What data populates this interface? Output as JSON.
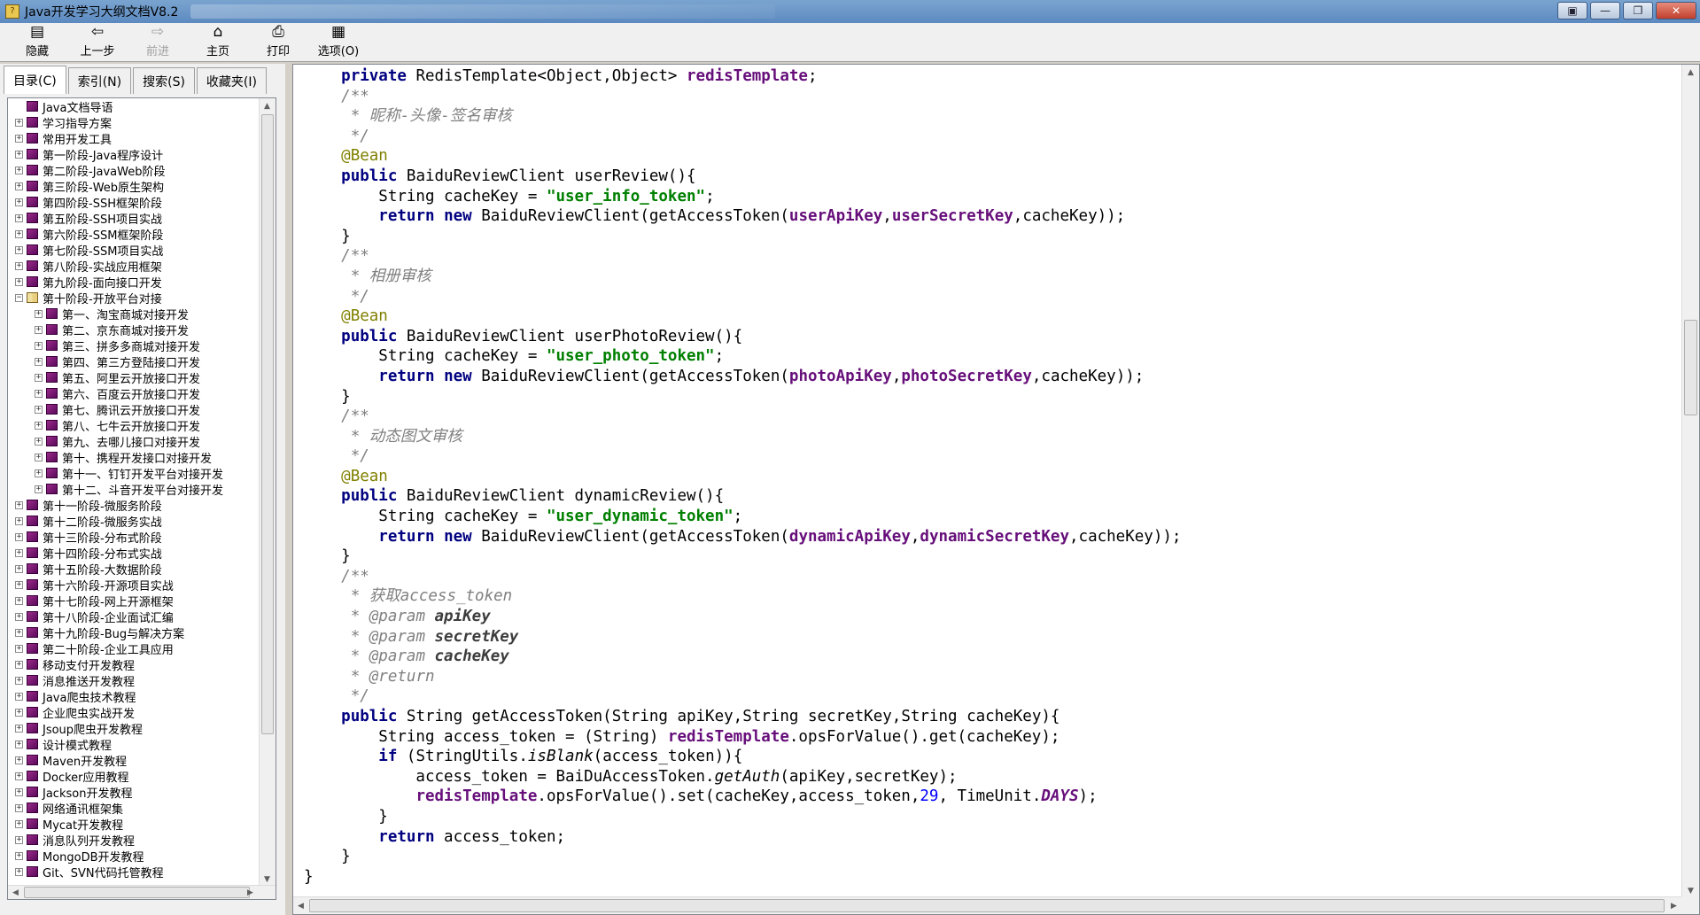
{
  "window": {
    "title": "Java开发学习大纲文档V8.2",
    "controls": [
      "▣",
      "—",
      "❐",
      "✕"
    ]
  },
  "toolbar": {
    "buttons": [
      {
        "label": "隐藏",
        "icon": "hide-icon",
        "glyph": "▤",
        "disabled": false
      },
      {
        "label": "上一步",
        "icon": "back-arrow-icon",
        "glyph": "⇦",
        "disabled": false
      },
      {
        "label": "前进",
        "icon": "forward-arrow-icon",
        "glyph": "⇨",
        "disabled": true
      },
      {
        "label": "主页",
        "icon": "home-icon",
        "glyph": "⌂",
        "disabled": false
      },
      {
        "label": "打印",
        "icon": "printer-icon",
        "glyph": "⎙",
        "disabled": false
      },
      {
        "label": "选项(O)",
        "icon": "options-icon",
        "glyph": "▦",
        "disabled": false
      }
    ]
  },
  "tabs": [
    {
      "label": "目录(C)",
      "active": true
    },
    {
      "label": "索引(N)",
      "active": false
    },
    {
      "label": "搜索(S)",
      "active": false
    },
    {
      "label": "收藏夹(I)",
      "active": false
    }
  ],
  "tree": {
    "items": [
      {
        "label": "Java文档导语",
        "level": 0,
        "expander": "",
        "open": false
      },
      {
        "label": "学习指导方案",
        "level": 0,
        "expander": "+",
        "open": false
      },
      {
        "label": "常用开发工具",
        "level": 0,
        "expander": "+",
        "open": false
      },
      {
        "label": "第一阶段-Java程序设计",
        "level": 0,
        "expander": "+",
        "open": false
      },
      {
        "label": "第二阶段-JavaWeb阶段",
        "level": 0,
        "expander": "+",
        "open": false
      },
      {
        "label": "第三阶段-Web原生架构",
        "level": 0,
        "expander": "+",
        "open": false
      },
      {
        "label": "第四阶段-SSH框架阶段",
        "level": 0,
        "expander": "+",
        "open": false
      },
      {
        "label": "第五阶段-SSH项目实战",
        "level": 0,
        "expander": "+",
        "open": false
      },
      {
        "label": "第六阶段-SSM框架阶段",
        "level": 0,
        "expander": "+",
        "open": false
      },
      {
        "label": "第七阶段-SSM项目实战",
        "level": 0,
        "expander": "+",
        "open": false
      },
      {
        "label": "第八阶段-实战应用框架",
        "level": 0,
        "expander": "+",
        "open": false
      },
      {
        "label": "第九阶段-面向接口开发",
        "level": 0,
        "expander": "+",
        "open": false
      },
      {
        "label": "第十阶段-开放平台对接",
        "level": 0,
        "expander": "−",
        "open": true
      },
      {
        "label": "第一、淘宝商城对接开发",
        "level": 1,
        "expander": "+",
        "open": false
      },
      {
        "label": "第二、京东商城对接开发",
        "level": 1,
        "expander": "+",
        "open": false
      },
      {
        "label": "第三、拼多多商城对接开发",
        "level": 1,
        "expander": "+",
        "open": false
      },
      {
        "label": "第四、第三方登陆接口开发",
        "level": 1,
        "expander": "+",
        "open": false
      },
      {
        "label": "第五、阿里云开放接口开发",
        "level": 1,
        "expander": "+",
        "open": false
      },
      {
        "label": "第六、百度云开放接口开发",
        "level": 1,
        "expander": "+",
        "open": false
      },
      {
        "label": "第七、腾讯云开放接口开发",
        "level": 1,
        "expander": "+",
        "open": false
      },
      {
        "label": "第八、七牛云开放接口开发",
        "level": 1,
        "expander": "+",
        "open": false
      },
      {
        "label": "第九、去哪儿接口对接开发",
        "level": 1,
        "expander": "+",
        "open": false
      },
      {
        "label": "第十、携程开发接口对接开发",
        "level": 1,
        "expander": "+",
        "open": false
      },
      {
        "label": "第十一、钉钉开发平台对接开发",
        "level": 1,
        "expander": "+",
        "open": false
      },
      {
        "label": "第十二、斗音开发平台对接开发",
        "level": 1,
        "expander": "+",
        "open": false
      },
      {
        "label": "第十一阶段-微服务阶段",
        "level": 0,
        "expander": "+",
        "open": false
      },
      {
        "label": "第十二阶段-微服务实战",
        "level": 0,
        "expander": "+",
        "open": false
      },
      {
        "label": "第十三阶段-分布式阶段",
        "level": 0,
        "expander": "+",
        "open": false
      },
      {
        "label": "第十四阶段-分布式实战",
        "level": 0,
        "expander": "+",
        "open": false
      },
      {
        "label": "第十五阶段-大数据阶段",
        "level": 0,
        "expander": "+",
        "open": false
      },
      {
        "label": "第十六阶段-开源项目实战",
        "level": 0,
        "expander": "+",
        "open": false
      },
      {
        "label": "第十七阶段-网上开源框架",
        "level": 0,
        "expander": "+",
        "open": false
      },
      {
        "label": "第十八阶段-企业面试汇编",
        "level": 0,
        "expander": "+",
        "open": false
      },
      {
        "label": "第十九阶段-Bug与解决方案",
        "level": 0,
        "expander": "+",
        "open": false
      },
      {
        "label": "第二十阶段-企业工具应用",
        "level": 0,
        "expander": "+",
        "open": false
      },
      {
        "label": "移动支付开发教程",
        "level": 0,
        "expander": "+",
        "open": false
      },
      {
        "label": "消息推送开发教程",
        "level": 0,
        "expander": "+",
        "open": false
      },
      {
        "label": "Java爬虫技术教程",
        "level": 0,
        "expander": "+",
        "open": false
      },
      {
        "label": "企业爬虫实战开发",
        "level": 0,
        "expander": "+",
        "open": false
      },
      {
        "label": "Jsoup爬虫开发教程",
        "level": 0,
        "expander": "+",
        "open": false
      },
      {
        "label": "设计模式教程",
        "level": 0,
        "expander": "+",
        "open": false
      },
      {
        "label": "Maven开发教程",
        "level": 0,
        "expander": "+",
        "open": false
      },
      {
        "label": "Docker应用教程",
        "level": 0,
        "expander": "+",
        "open": false
      },
      {
        "label": "Jackson开发教程",
        "level": 0,
        "expander": "+",
        "open": false
      },
      {
        "label": "网络通讯框架集",
        "level": 0,
        "expander": "+",
        "open": false
      },
      {
        "label": "Mycat开发教程",
        "level": 0,
        "expander": "+",
        "open": false
      },
      {
        "label": "消息队列开发教程",
        "level": 0,
        "expander": "+",
        "open": false
      },
      {
        "label": "MongoDB开发教程",
        "level": 0,
        "expander": "+",
        "open": false
      },
      {
        "label": "Git、SVN代码托管教程",
        "level": 0,
        "expander": "+",
        "open": false
      }
    ]
  },
  "code": {
    "lines": [
      [
        [
          "    ",
          ""
        ],
        [
          "private",
          "kw"
        ],
        [
          " RedisTemplate<Object,Object> ",
          ""
        ],
        [
          "redisTemplate",
          "fld"
        ],
        [
          ";",
          ""
        ]
      ],
      [
        [
          "    ",
          ""
        ],
        [
          "/**",
          "cm"
        ]
      ],
      [
        [
          "     ",
          ""
        ],
        [
          "* 昵称-头像-签名审核",
          "cm"
        ]
      ],
      [
        [
          "     ",
          ""
        ],
        [
          "*/",
          "cm"
        ]
      ],
      [
        [
          "    ",
          ""
        ],
        [
          "@Bean",
          "ann"
        ]
      ],
      [
        [
          "    ",
          ""
        ],
        [
          "public",
          "kw"
        ],
        [
          " BaiduReviewClient userReview(){",
          ""
        ]
      ],
      [
        [
          "        String cacheKey = ",
          ""
        ],
        [
          "\"user_info_token\"",
          "str"
        ],
        [
          ";",
          ""
        ]
      ],
      [
        [
          "        ",
          ""
        ],
        [
          "return",
          "kw"
        ],
        [
          " ",
          ""
        ],
        [
          "new",
          "kw"
        ],
        [
          " BaiduReviewClient(getAccessToken(",
          ""
        ],
        [
          "userApiKey",
          "fld"
        ],
        [
          ",",
          ""
        ],
        [
          "userSecretKey",
          "fld"
        ],
        [
          ",cacheKey));",
          ""
        ]
      ],
      [
        [
          "    }",
          ""
        ]
      ],
      [
        [
          "    ",
          ""
        ],
        [
          "/**",
          "cm"
        ]
      ],
      [
        [
          "     ",
          ""
        ],
        [
          "* 相册审核",
          "cm"
        ]
      ],
      [
        [
          "     ",
          ""
        ],
        [
          "*/",
          "cm"
        ]
      ],
      [
        [
          "    ",
          ""
        ],
        [
          "@Bean",
          "ann"
        ]
      ],
      [
        [
          "    ",
          ""
        ],
        [
          "public",
          "kw"
        ],
        [
          " BaiduReviewClient userPhotoReview(){",
          ""
        ]
      ],
      [
        [
          "        String cacheKey = ",
          ""
        ],
        [
          "\"user_photo_token\"",
          "str"
        ],
        [
          ";",
          ""
        ]
      ],
      [
        [
          "        ",
          ""
        ],
        [
          "return",
          "kw"
        ],
        [
          " ",
          ""
        ],
        [
          "new",
          "kw"
        ],
        [
          " BaiduReviewClient(getAccessToken(",
          ""
        ],
        [
          "photoApiKey",
          "fld"
        ],
        [
          ",",
          ""
        ],
        [
          "photoSecretKey",
          "fld"
        ],
        [
          ",cacheKey));",
          ""
        ]
      ],
      [
        [
          "    }",
          ""
        ]
      ],
      [
        [
          "    ",
          ""
        ],
        [
          "/**",
          "cm"
        ]
      ],
      [
        [
          "     ",
          ""
        ],
        [
          "* 动态图文审核",
          "cm"
        ]
      ],
      [
        [
          "     ",
          ""
        ],
        [
          "*/",
          "cm"
        ]
      ],
      [
        [
          "    ",
          ""
        ],
        [
          "@Bean",
          "ann"
        ]
      ],
      [
        [
          "    ",
          ""
        ],
        [
          "public",
          "kw"
        ],
        [
          " BaiduReviewClient dynamicReview(){",
          ""
        ]
      ],
      [
        [
          "        String cacheKey = ",
          ""
        ],
        [
          "\"user_dynamic_token\"",
          "str"
        ],
        [
          ";",
          ""
        ]
      ],
      [
        [
          "        ",
          ""
        ],
        [
          "return",
          "kw"
        ],
        [
          " ",
          ""
        ],
        [
          "new",
          "kw"
        ],
        [
          " BaiduReviewClient(getAccessToken(",
          ""
        ],
        [
          "dynamicApiKey",
          "fld"
        ],
        [
          ",",
          ""
        ],
        [
          "dynamicSecretKey",
          "fld"
        ],
        [
          ",cacheKey));",
          ""
        ]
      ],
      [
        [
          "    }",
          ""
        ]
      ],
      [
        [
          "    ",
          ""
        ],
        [
          "/**",
          "cm"
        ]
      ],
      [
        [
          "     ",
          ""
        ],
        [
          "* 获取access_token",
          "cm"
        ]
      ],
      [
        [
          "     ",
          ""
        ],
        [
          "* ",
          "cm"
        ],
        [
          "@param",
          "cmtag"
        ],
        [
          " apiKey",
          "cmparam"
        ]
      ],
      [
        [
          "     ",
          ""
        ],
        [
          "* ",
          "cm"
        ],
        [
          "@param",
          "cmtag"
        ],
        [
          " secretKey",
          "cmparam"
        ]
      ],
      [
        [
          "     ",
          ""
        ],
        [
          "* ",
          "cm"
        ],
        [
          "@param",
          "cmtag"
        ],
        [
          " cacheKey",
          "cmparam"
        ]
      ],
      [
        [
          "     ",
          ""
        ],
        [
          "* ",
          "cm"
        ],
        [
          "@return",
          "cmtag"
        ]
      ],
      [
        [
          "     ",
          ""
        ],
        [
          "*/",
          "cm"
        ]
      ],
      [
        [
          "    ",
          ""
        ],
        [
          "public",
          "kw"
        ],
        [
          " String getAccessToken(String apiKey,String secretKey,String cacheKey){",
          ""
        ]
      ],
      [
        [
          "        String access_token = (String) ",
          ""
        ],
        [
          "redisTemplate",
          "fld"
        ],
        [
          ".opsForValue().get(cacheKey);",
          ""
        ]
      ],
      [
        [
          "        ",
          ""
        ],
        [
          "if",
          "kw"
        ],
        [
          " (StringUtils.",
          ""
        ],
        [
          "isBlank",
          "ital"
        ],
        [
          "(access_token)){",
          ""
        ]
      ],
      [
        [
          "            access_token = BaiDuAccessToken.",
          ""
        ],
        [
          "getAuth",
          "ital"
        ],
        [
          "(apiKey,secretKey);",
          ""
        ]
      ],
      [
        [
          "            ",
          ""
        ],
        [
          "redisTemplate",
          "fld"
        ],
        [
          ".opsForValue().set(cacheKey,access_token,",
          ""
        ],
        [
          "29",
          "num"
        ],
        [
          ", TimeUnit.",
          ""
        ],
        [
          "DAYS",
          "italb"
        ],
        [
          ");",
          ""
        ]
      ],
      [
        [
          "        }",
          ""
        ]
      ],
      [
        [
          "        ",
          ""
        ],
        [
          "return",
          "kw"
        ],
        [
          " access_token;",
          ""
        ]
      ],
      [
        [
          "    }",
          ""
        ]
      ],
      [
        [
          "}",
          ""
        ]
      ]
    ]
  }
}
